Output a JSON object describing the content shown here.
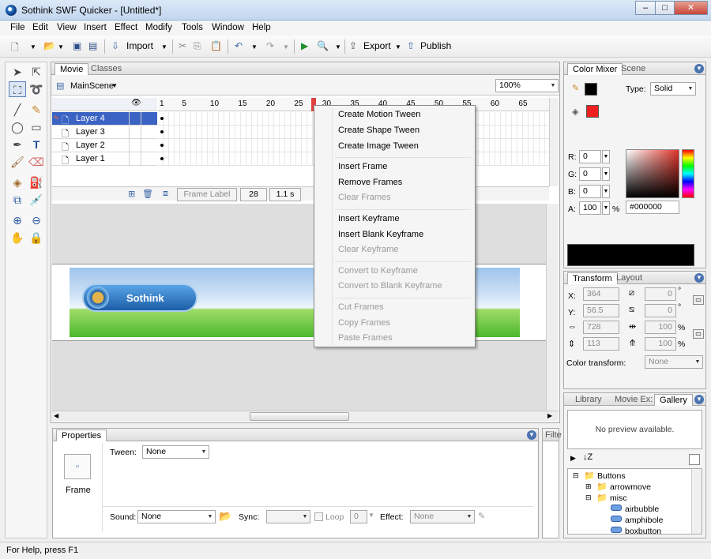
{
  "window": {
    "title": "Sothink SWF Quicker - [Untitled*]",
    "min": "–",
    "max": "□",
    "close": "✕"
  },
  "menu": [
    "File",
    "Edit",
    "View",
    "Insert",
    "Effect",
    "Modify",
    "Tools",
    "Window",
    "Help"
  ],
  "toolbar": {
    "import": "Import",
    "export": "Export",
    "publish": "Publish"
  },
  "stage_tabs": [
    "Movie",
    "Classes"
  ],
  "scene": {
    "name": "MainScene",
    "zoom": "100%"
  },
  "timeline": {
    "ruler": [
      "1",
      "5",
      "10",
      "15",
      "20",
      "25",
      "30",
      "35",
      "40",
      "45",
      "50",
      "55",
      "60",
      "65"
    ],
    "layers": [
      "Layer 4",
      "Layer 3",
      "Layer 2",
      "Layer 1"
    ],
    "frame_label": "Frame Label",
    "frame_number": "28",
    "time": "1.1 s"
  },
  "context_menu": {
    "groups": [
      [
        {
          "label": "Create Motion Tween",
          "enabled": true
        },
        {
          "label": "Create Shape Tween",
          "enabled": true
        },
        {
          "label": "Create Image Tween",
          "enabled": true
        }
      ],
      [
        {
          "label": "Insert Frame",
          "enabled": true
        },
        {
          "label": "Remove Frames",
          "enabled": true
        },
        {
          "label": "Clear Frames",
          "enabled": false
        }
      ],
      [
        {
          "label": "Insert Keyframe",
          "enabled": true
        },
        {
          "label": "Insert Blank Keyframe",
          "enabled": true
        },
        {
          "label": "Clear Keyframe",
          "enabled": false
        }
      ],
      [
        {
          "label": "Convert to Keyframe",
          "enabled": false
        },
        {
          "label": "Convert to Blank Keyframe",
          "enabled": false
        }
      ],
      [
        {
          "label": "Cut Frames",
          "enabled": false
        },
        {
          "label": "Copy Frames",
          "enabled": false
        },
        {
          "label": "Paste Frames",
          "enabled": false
        }
      ]
    ]
  },
  "banner": {
    "text": "Sothink"
  },
  "properties": {
    "tab": "Properties",
    "filter_tab": "Filte",
    "object": "Frame",
    "tween_label": "Tween:",
    "tween_value": "None",
    "sound_label": "Sound:",
    "sound_value": "None",
    "sync_label": "Sync:",
    "loop_label": "Loop",
    "loop_count": "0",
    "effect_label": "Effect:",
    "effect_value": "None"
  },
  "color_mixer": {
    "tabs": [
      "Color Mixer",
      "Scene"
    ],
    "type_label": "Type:",
    "type_value": "Solid",
    "r_label": "R:",
    "r": "0",
    "g_label": "G:",
    "g": "0",
    "b_label": "B:",
    "b": "0",
    "a_label": "A:",
    "a": "100",
    "percent": "%",
    "hex": "#000000",
    "fill_color": "#ef2020"
  },
  "transform": {
    "tabs": [
      "Transform",
      "Layout"
    ],
    "x_label": "X:",
    "x": "364",
    "y_label": "Y:",
    "y": "56.5",
    "w": "728",
    "h": "113",
    "skew1": "0",
    "skew2": "0",
    "scale1": "100",
    "scale2": "100",
    "deg": "°",
    "pct": "%",
    "color_transform_label": "Color transform:",
    "color_transform_value": "None"
  },
  "gallery": {
    "tabs": [
      "Library",
      "Movie Ex:",
      "Gallery"
    ],
    "preview": "No preview available.",
    "tree": [
      "Buttons",
      "arrowmove",
      "misc",
      "airbubble",
      "amphibole",
      "boxbutton"
    ]
  },
  "status": {
    "text": "For Help, press F1"
  }
}
